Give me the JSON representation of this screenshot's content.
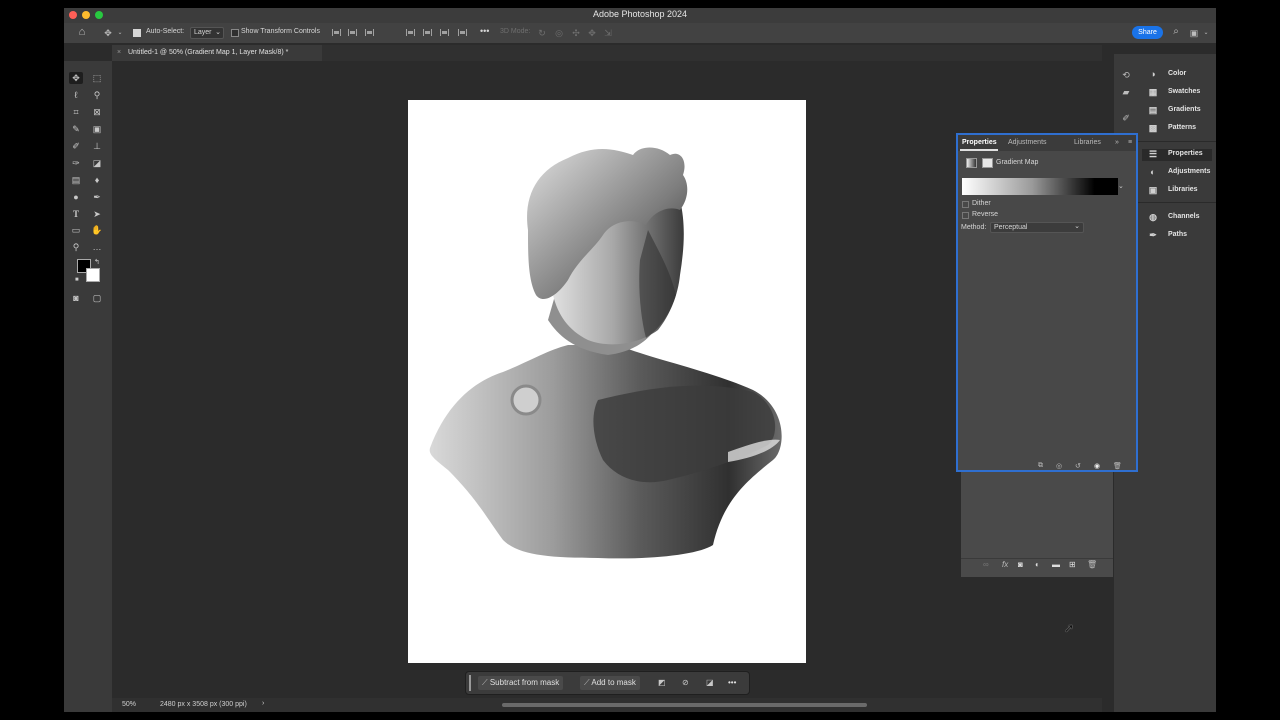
{
  "window": {
    "title": "Adobe Photoshop 2024"
  },
  "options_bar": {
    "auto_select_label": "Auto-Select:",
    "auto_select_value": "Layer",
    "show_transform_label": "Show Transform Controls",
    "mode_3d_label": "3D Mode:",
    "share_label": "Share",
    "more": "•••"
  },
  "document_tab": {
    "title": "Untitled-1 @ 50% (Gradient Map 1, Layer Mask/8) *",
    "close": "×"
  },
  "contextual_taskbar": {
    "subtract": "Subtract from mask",
    "add": "Add to mask",
    "more": "•••"
  },
  "status": {
    "zoom": "50%",
    "doc_info": "2480 px x 3508 px (300 ppi)",
    "arrow": "›"
  },
  "right_panels": {
    "group1": [
      "Color",
      "Swatches",
      "Gradients",
      "Patterns"
    ],
    "group2": [
      "Properties",
      "Adjustments",
      "Libraries"
    ],
    "group3": [
      "Channels",
      "Paths"
    ]
  },
  "properties_panel": {
    "tabs": [
      "Properties",
      "Adjustments",
      "Libraries"
    ],
    "header": "Gradient Map",
    "dither": "Dither",
    "reverse": "Reverse",
    "method_label": "Method:",
    "method_value": "Perceptual"
  },
  "colors": {
    "accent": "#1a73e8",
    "panel_border": "#2f6fd0",
    "app_bg": "#2b2b2b",
    "foreground": "#000000",
    "background": "#ffffff"
  }
}
